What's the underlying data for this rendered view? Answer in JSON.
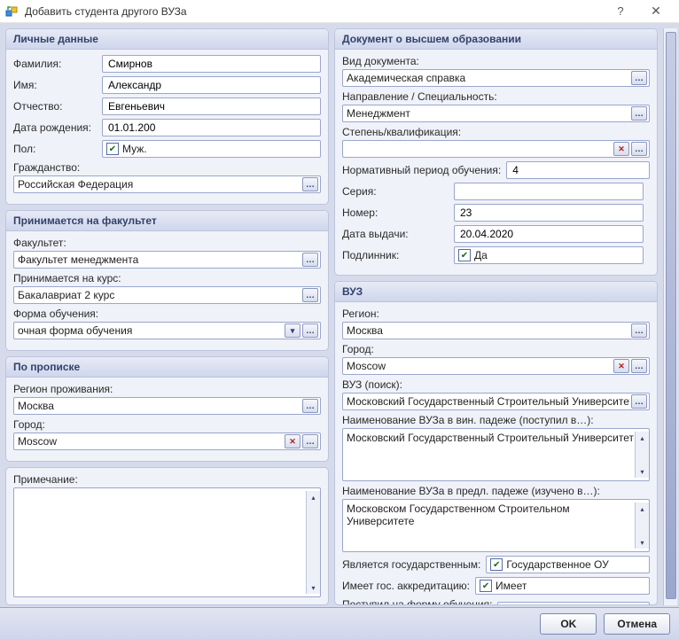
{
  "window": {
    "title": "Добавить студента другого ВУЗа"
  },
  "personal": {
    "header": "Личные данные",
    "surname_lbl": "Фамилия:",
    "surname": "Смирнов",
    "name_lbl": "Имя:",
    "name": "Александр",
    "patronymic_lbl": "Отчество:",
    "patronymic": "Евгеньевич",
    "dob_lbl": "Дата рождения:",
    "dob": "01.01.200",
    "sex_lbl": "Пол:",
    "sex": "Муж.",
    "citizenship_lbl": "Гражданство:",
    "citizenship": "Российская Федерация"
  },
  "faculty": {
    "header": "Принимается на факультет",
    "fac_lbl": "Факультет:",
    "fac": "Факультет менеджмента",
    "course_lbl": "Принимается на курс:",
    "course": "Бакалавриат 2 курс",
    "form_lbl": "Форма обучения:",
    "form": "очная форма обучения"
  },
  "residence": {
    "header": "По прописке",
    "region_lbl": "Регион проживания:",
    "region": "Москва",
    "city_lbl": "Город:",
    "city": "Moscow"
  },
  "note": {
    "lbl": "Примечание:",
    "value": ""
  },
  "doc": {
    "header": "Документ о высшем образовании",
    "type_lbl": "Вид документа:",
    "type": "Академическая справка",
    "spec_lbl": "Направление / Специальность:",
    "spec": "Менеджмент",
    "degree_lbl": "Степень/квалификация:",
    "degree": "",
    "norm_lbl": "Нормативный период обучения:",
    "norm": "4",
    "series_lbl": "Серия:",
    "series": "",
    "number_lbl": "Номер:",
    "number": "23",
    "issue_lbl": "Дата выдачи:",
    "issue": "20.04.2020",
    "orig_lbl": "Подлинник:",
    "orig": "Да"
  },
  "vuz": {
    "header": "ВУЗ",
    "region_lbl": "Регион:",
    "region": "Москва",
    "city_lbl": "Город:",
    "city": "Moscow",
    "search_lbl": "ВУЗ (поиск):",
    "search": "Московский Государственный Строительный Университет",
    "acc_lbl": "Наименование ВУЗа в вин. падеже (поступил в…):",
    "acc_val": "Московский Государственный Строительный Университет",
    "prep_lbl": "Наименование ВУЗа в предл. падеже (изучено в…):",
    "prep_val": "Московском Государственном Строительном Университете",
    "state_lbl": "Является государственным:",
    "state": "Государственное ОУ",
    "accr_lbl": "Имеет гос. аккредитацию:",
    "accr": "Имеет",
    "enroll_lbl": "Поступил на форму обучения:",
    "enroll": ""
  },
  "footer": {
    "ok": "OK",
    "cancel": "Отмена"
  }
}
